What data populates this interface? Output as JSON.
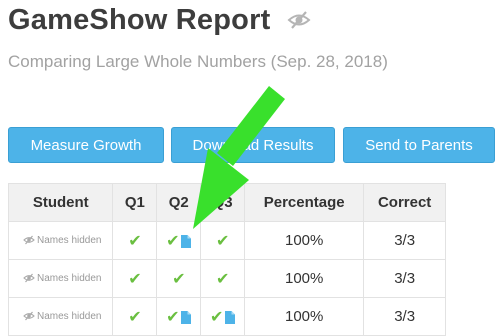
{
  "header": {
    "title": "GameShow Report",
    "subtitle": "Comparing Large Whole Numbers (Sep. 28, 2018)",
    "visibility_icon": "eye-slash-icon"
  },
  "actions": {
    "measure_growth": "Measure Growth",
    "download_results": "Download Results",
    "send_to_parents": "Send to Parents"
  },
  "table": {
    "columns": [
      "Student",
      "Q1",
      "Q2",
      "Q3",
      "Percentage",
      "Correct"
    ],
    "rows": [
      {
        "student": "Names hidden",
        "q1": "✔",
        "q2": "✔",
        "q3": "✔",
        "percentage": "100%",
        "correct": "3/3"
      },
      {
        "student": "Names hidden",
        "q1": "✔",
        "q2": "✔",
        "q3": "✔",
        "percentage": "100%",
        "correct": "3/3"
      },
      {
        "student": "Names hidden",
        "q1": "✔",
        "q2": "✔",
        "q3": "✔",
        "percentage": "100%",
        "correct": "3/3"
      }
    ]
  },
  "colors": {
    "button": "#4db3e8",
    "check": "#6abf40",
    "doc_icon": "#4db3e8",
    "arrow": "#39e02c"
  }
}
